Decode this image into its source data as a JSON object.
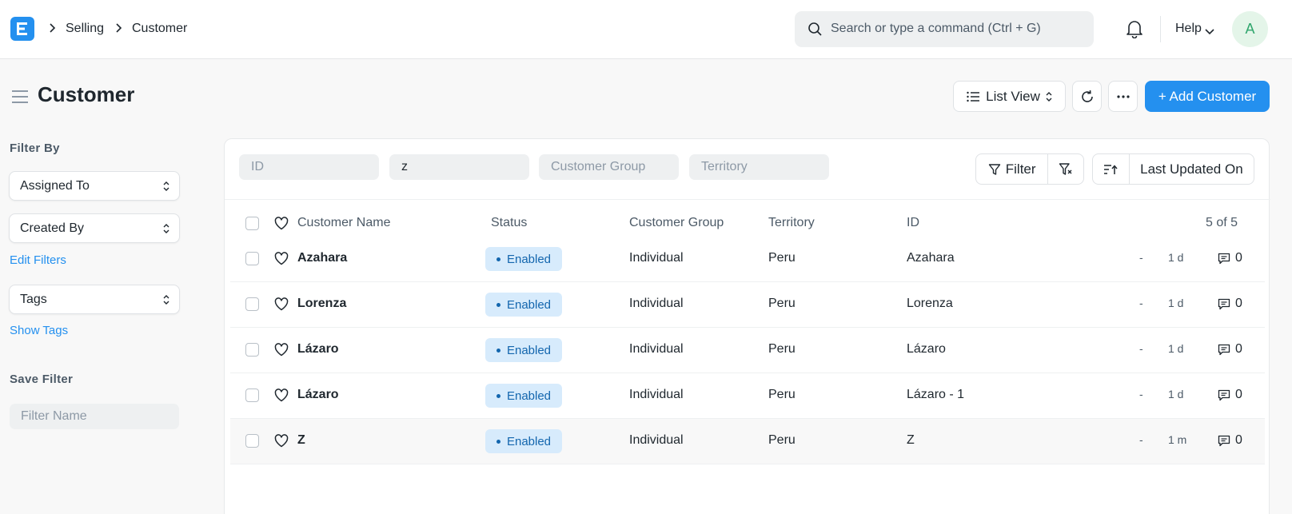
{
  "navbar": {
    "breadcrumbs": [
      "Selling",
      "Customer"
    ],
    "search_placeholder": "Search or type a command (Ctrl + G)",
    "help_label": "Help",
    "avatar_initial": "A",
    "brand_color": "#2490ef"
  },
  "page": {
    "title": "Customer",
    "view_label": "List View",
    "add_label": "+ Add Customer"
  },
  "sidebar": {
    "filter_by_heading": "Filter By",
    "assigned_to": "Assigned To",
    "created_by": "Created By",
    "edit_filters": "Edit Filters",
    "tags": "Tags",
    "show_tags": "Show Tags",
    "save_filter_heading": "Save Filter",
    "filter_name_placeholder": "Filter Name"
  },
  "filters": {
    "id_placeholder": "ID",
    "name_value": "z",
    "customer_group_placeholder": "Customer Group",
    "territory_placeholder": "Territory",
    "filter_label": "Filter",
    "sort_label": "Last Updated On"
  },
  "table": {
    "headers": {
      "name": "Customer Name",
      "status": "Status",
      "group": "Customer Group",
      "territory": "Territory",
      "id": "ID",
      "count": "5 of 5"
    },
    "rows": [
      {
        "name": "Azahara",
        "status": "Enabled",
        "group": "Individual",
        "territory": "Peru",
        "id": "Azahara",
        "dash": "-",
        "modified": "1 d",
        "comments": "0"
      },
      {
        "name": "Lorenza",
        "status": "Enabled",
        "group": "Individual",
        "territory": "Peru",
        "id": "Lorenza",
        "dash": "-",
        "modified": "1 d",
        "comments": "0"
      },
      {
        "name": "Lázaro",
        "status": "Enabled",
        "group": "Individual",
        "territory": "Peru",
        "id": "Lázaro",
        "dash": "-",
        "modified": "1 d",
        "comments": "0"
      },
      {
        "name": "Lázaro",
        "status": "Enabled",
        "group": "Individual",
        "territory": "Peru",
        "id": "Lázaro - 1",
        "dash": "-",
        "modified": "1 d",
        "comments": "0"
      },
      {
        "name": "Z",
        "status": "Enabled",
        "group": "Individual",
        "territory": "Peru",
        "id": "Z",
        "dash": "-",
        "modified": "1 m",
        "comments": "0"
      }
    ]
  }
}
